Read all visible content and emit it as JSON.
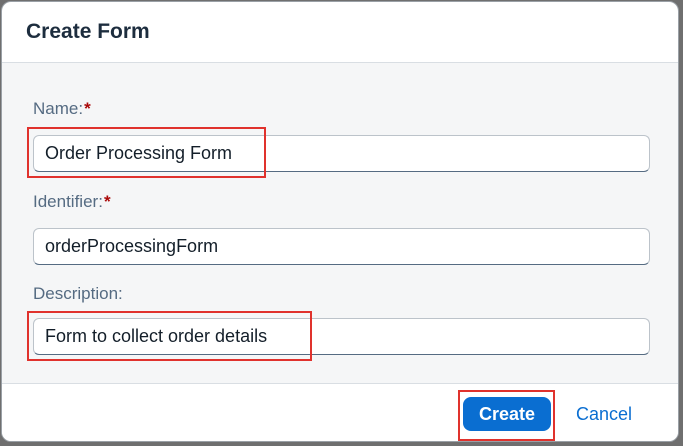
{
  "dialog": {
    "title": "Create Form",
    "fields": {
      "name": {
        "label": "Name:",
        "required_mark": "*",
        "value": "Order Processing Form"
      },
      "identifier": {
        "label": "Identifier:",
        "required_mark": "*",
        "value": "orderProcessingForm"
      },
      "description": {
        "label": "Description:",
        "value": "Form to collect order details"
      }
    },
    "buttons": {
      "create_label": "Create",
      "cancel_label": "Cancel"
    }
  },
  "colors": {
    "accent": "#0a6ed1",
    "required": "#aa0808",
    "highlight": "#e0322d"
  }
}
